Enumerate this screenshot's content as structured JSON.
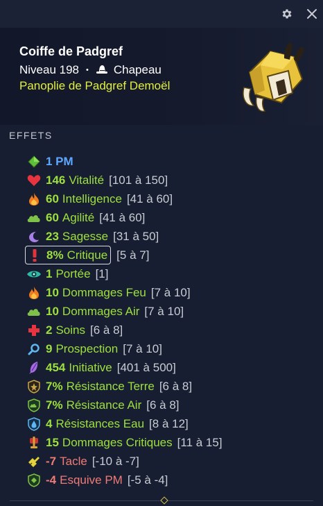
{
  "window": {
    "settings_icon": "gear-icon",
    "close_icon": "close-icon"
  },
  "item": {
    "name": "Coiffe de Padgref",
    "level": "Niveau 198",
    "separator": "•",
    "type": "Chapeau",
    "set": "Panoplie de Padgref Demoël"
  },
  "effects_title": "EFFETS",
  "effects": [
    {
      "icon": "pm-diamond-icon",
      "value": "1 PM",
      "name": "",
      "range": "",
      "color": "blue"
    },
    {
      "icon": "heart-icon",
      "value": "146",
      "name": "Vitalité",
      "range": "[101 à 150]",
      "color": "green"
    },
    {
      "icon": "fire-icon",
      "value": "60",
      "name": "Intelligence",
      "range": "[41 à 60]",
      "color": "green"
    },
    {
      "icon": "air-cloud-icon",
      "value": "60",
      "name": "Agilité",
      "range": "[41 à 60]",
      "color": "green"
    },
    {
      "icon": "moon-icon",
      "value": "23",
      "name": "Sagesse",
      "range": "[31 à 50]",
      "color": "green"
    },
    {
      "icon": "critical-exclamation-icon",
      "value": "8%",
      "name": "Critique",
      "range": "[5 à 7]",
      "color": "green",
      "highlight": true
    },
    {
      "icon": "eye-icon",
      "value": "1",
      "name": "Portée",
      "range": "[1]",
      "color": "green"
    },
    {
      "icon": "fire-icon",
      "value": "10",
      "name": "Dommages Feu",
      "range": "[7 à 10]",
      "color": "green"
    },
    {
      "icon": "air-cloud-icon",
      "value": "10",
      "name": "Dommages Air",
      "range": "[7 à 10]",
      "color": "green"
    },
    {
      "icon": "heal-cross-icon",
      "value": "2",
      "name": "Soins",
      "range": "[6 à 8]",
      "color": "green"
    },
    {
      "icon": "magnifier-icon",
      "value": "9",
      "name": "Prospection",
      "range": "[7 à 10]",
      "color": "green"
    },
    {
      "icon": "initiative-feather-icon",
      "value": "454",
      "name": "Initiative",
      "range": "[401 à 500]",
      "color": "green"
    },
    {
      "icon": "shield-earth-icon",
      "value": "7%",
      "name": "Résistance Terre",
      "range": "[6 à 8]",
      "color": "green"
    },
    {
      "icon": "shield-air-icon",
      "value": "7%",
      "name": "Résistance Air",
      "range": "[6 à 8]",
      "color": "green"
    },
    {
      "icon": "shield-water-icon",
      "value": "4",
      "name": "Résistances Eau",
      "range": "[8 à 12]",
      "color": "green"
    },
    {
      "icon": "critical-damage-icon",
      "value": "15",
      "name": "Dommages Critiques",
      "range": "[11 à 15]",
      "color": "green"
    },
    {
      "icon": "tackle-icon",
      "value": "-7",
      "name": "Tacle",
      "range": "[-10 à -7]",
      "color": "red"
    },
    {
      "icon": "dodge-pm-shield-icon",
      "value": "-4",
      "name": "Esquive PM",
      "range": "[-5 à -4]",
      "color": "red"
    }
  ],
  "colors": {
    "positive": "#9de03e",
    "negative": "#f07b76",
    "pm": "#5ea7ff",
    "set_name": "#e2ef3c"
  }
}
